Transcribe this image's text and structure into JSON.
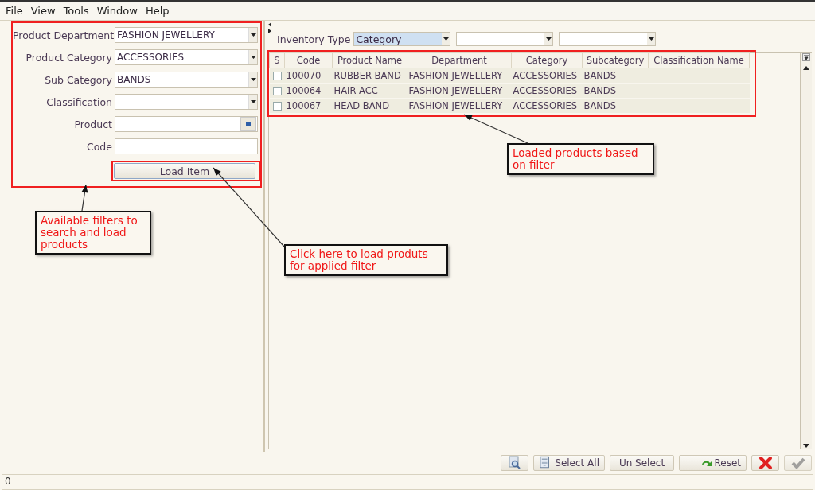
{
  "menu": [
    {
      "label": "File"
    },
    {
      "label": "View"
    },
    {
      "label": "Tools"
    },
    {
      "label": "Window"
    },
    {
      "label": "Help"
    }
  ],
  "filters": {
    "annotated": true,
    "fields": [
      {
        "label": "Product Department",
        "kind": "dropdown",
        "value": "FASHION JEWELLERY"
      },
      {
        "label": "Product Category",
        "kind": "dropdown",
        "value": "ACCESSORIES"
      },
      {
        "label": "Sub Category",
        "kind": "dropdown",
        "value": "BANDS"
      },
      {
        "label": "Classification",
        "kind": "dropdown"
      },
      {
        "label": "Product",
        "kind": "lookup"
      },
      {
        "label": "Code",
        "kind": "text"
      }
    ],
    "load_button": {
      "label": "Load Item",
      "annotated": true
    }
  },
  "inventory": {
    "label": "Inventory Type",
    "dropdowns": [
      {
        "value": "Category",
        "focused": true
      },
      {
        "focused": false
      },
      {
        "focused": false
      }
    ]
  },
  "table": {
    "annotated": true,
    "columns": [
      "S",
      "Code",
      "Product Name",
      "Department",
      "Category",
      "Subcategory",
      "Classification Name"
    ],
    "rows": [
      {
        "checked": false,
        "cells": [
          "",
          "100070",
          "RUBBER BAND",
          "FASHION JEWELLERY",
          "ACCESSORIES",
          "BANDS"
        ]
      },
      {
        "checked": false,
        "cells": [
          "",
          "100064",
          "HAIR ACC",
          "FASHION JEWELLERY",
          "ACCESSORIES",
          "BANDS"
        ]
      },
      {
        "checked": false,
        "cells": [
          "",
          "100067",
          "HEAD BAND",
          "FASHION JEWELLERY",
          "ACCESSORIES",
          "BANDS"
        ]
      }
    ]
  },
  "toolbar": [
    {
      "kind": "preview"
    },
    {
      "kind": "select_all",
      "label": "Select All"
    },
    {
      "kind": "plain",
      "label": "Un Select"
    },
    {
      "kind": "reset",
      "label": "Reset"
    },
    {
      "kind": "cancel"
    },
    {
      "kind": "confirm",
      "disabled": true
    }
  ],
  "status_bar": {
    "text": "0"
  },
  "callouts": [
    {
      "text": "Available filters to search and load products"
    },
    {
      "text": "Click here to load produts for applied filter"
    },
    {
      "text": "Loaded products based on filter"
    }
  ]
}
